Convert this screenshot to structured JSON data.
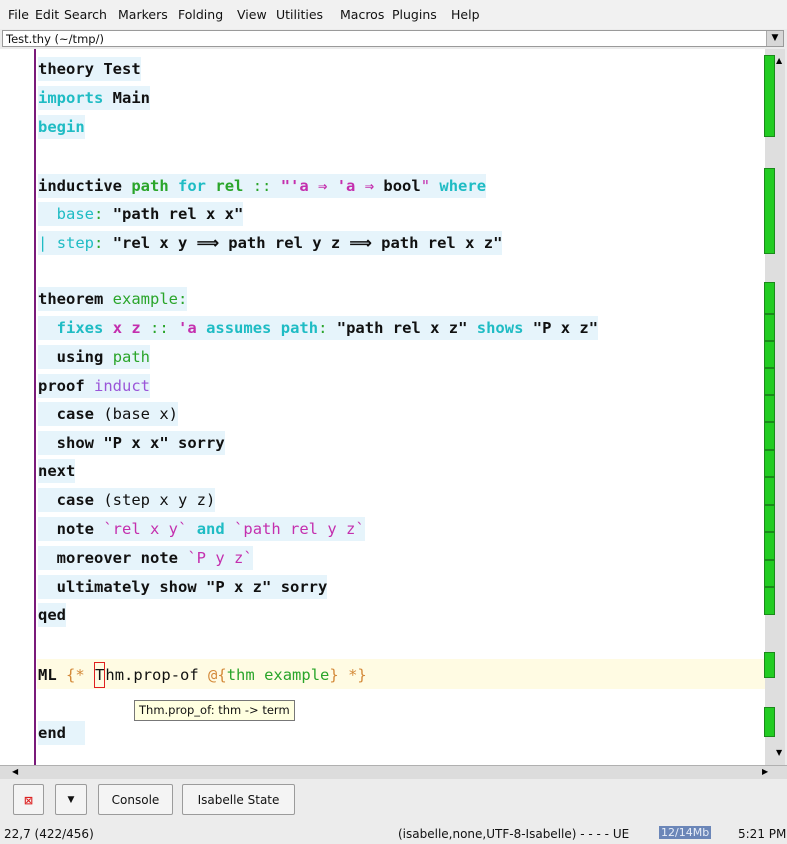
{
  "menu": {
    "file": "File",
    "edit": "Edit",
    "search": "Search",
    "markers": "Markers",
    "folding": "Folding",
    "view": "View",
    "utilities": "Utilities",
    "macros": "Macros",
    "plugins": "Plugins",
    "help": "Help"
  },
  "buffer": {
    "label": "Test.thy (~/tmp/)"
  },
  "tooltip": "Thm.prop_of: thm -> term",
  "buttons": {
    "console": "Console",
    "isabelle_state": "Isabelle State"
  },
  "status": {
    "position": "22,7 (422/456)",
    "mode": "(isabelle,none,UTF-8-Isabelle) - - - - UE",
    "memory": "12/14Mb",
    "time": "5:21 PM"
  },
  "code": {
    "l1": [
      "theory",
      "Test"
    ],
    "l2": [
      "imports",
      "Main"
    ],
    "l3": [
      "begin"
    ],
    "l5": [
      "inductive",
      "path",
      "for",
      "rel",
      "::",
      "\"'a ⇒ 'a ⇒ ",
      "bool",
      "\"",
      "where"
    ],
    "l6": [
      "base",
      ":",
      "\"path rel x x\""
    ],
    "l7": [
      "|",
      "step",
      ":",
      "\"rel x y ⟹ path rel y z ⟹ path rel x z\""
    ],
    "l9": [
      "theorem",
      "example",
      ":"
    ],
    "l10": [
      "fixes",
      "x z",
      "::",
      "'a",
      "assumes",
      "path",
      ":",
      "\"path rel x z\"",
      "shows",
      "\"P x z\""
    ],
    "l11": [
      "using",
      "path"
    ],
    "l12": [
      "proof",
      "induct"
    ],
    "l13": [
      "case",
      "(base x)"
    ],
    "l14": [
      "show",
      "\"P x x\"",
      "sorry"
    ],
    "l15": [
      "next"
    ],
    "l16": [
      "case",
      "(step x y z)"
    ],
    "l17": [
      "note",
      "`rel x y`",
      "and",
      "`path rel y z`"
    ],
    "l18": [
      "moreover",
      "note",
      "`P y z`"
    ],
    "l19": [
      "ultimately",
      "show",
      "\"P x z\"",
      "sorry"
    ],
    "l20": [
      "qed"
    ],
    "l22": [
      "ML",
      "{*",
      "T",
      "hm.prop-of",
      "@{",
      "thm",
      "example",
      "}",
      "*}"
    ],
    "l24": [
      "end"
    ]
  },
  "colors": {
    "keyword": "#111111",
    "command_cyan": "#1fbcc4",
    "fixed_green": "#2aa52a",
    "free_magenta": "#c42fae",
    "method_purple": "#9a55d8",
    "antiquote_orange": "#d48a3a",
    "unprocessed_bg": "#e6f4fb",
    "gutter_green": "#22cc22"
  }
}
